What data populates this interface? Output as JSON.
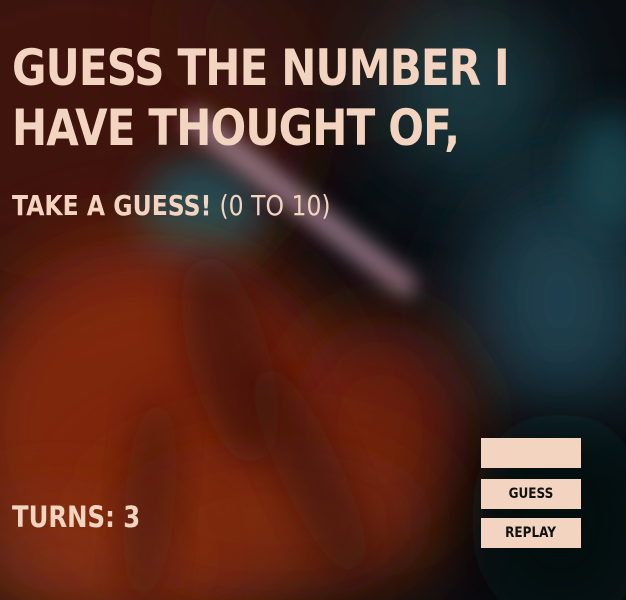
{
  "game": {
    "title": "GUESS THE NUMBER I HAVE THOUGHT OF,",
    "prompt": "TAKE A GUESS!",
    "range": "(0 TO 10)",
    "turns_label": "TURNS: 3",
    "guess_input": {
      "value": "",
      "placeholder": ""
    },
    "guess_button": "GUESS",
    "replay_button": "REPLAY"
  },
  "colors": {
    "text": "#f2d4c0",
    "button_bg": "#f2d4c0",
    "button_text": "#111111",
    "background": "#0a0d10"
  }
}
